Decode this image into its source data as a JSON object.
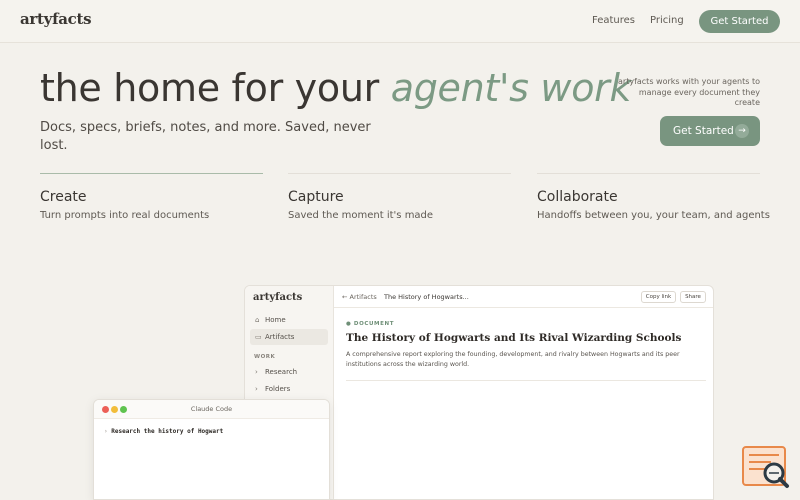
{
  "nav": {
    "logo": "artyfacts",
    "links": [
      "Features",
      "Pricing"
    ],
    "cta": "Get Started"
  },
  "hero": {
    "title_plain": "the home for your",
    "title_accent": "agent's work",
    "subtitle": "Docs, specs, briefs, notes, and more. Saved, never lost.",
    "side_note": "artyfacts works with your agents to manage every document they create",
    "cta": "Get Started",
    "cta_icon": "arrow-right-icon"
  },
  "features": [
    {
      "title": "Create",
      "desc": "Turn prompts into real documents"
    },
    {
      "title": "Capture",
      "desc": "Saved the moment it's made"
    },
    {
      "title": "Collaborate",
      "desc": "Handoffs between you, your team, and agents"
    }
  ],
  "app_preview": {
    "logo": "artyfacts",
    "sidebar": {
      "items": [
        {
          "label": "Home",
          "icon": "home-icon"
        },
        {
          "label": "Artifacts",
          "icon": "folder-icon"
        }
      ],
      "section": "WORK",
      "work_items": [
        {
          "label": "Research",
          "icon": "chevron-right-icon"
        },
        {
          "label": "Folders",
          "icon": "chevron-right-icon"
        }
      ]
    },
    "topbar": {
      "back": "← Artifacts",
      "current": "The History of Hogwarts...",
      "copy_link": "Copy link",
      "share": "Share"
    },
    "document": {
      "label": "● DOCUMENT",
      "title": "The History of Hogwarts and Its Rival Wizarding Schools",
      "description": "A comprehensive report exploring the founding, development, and rivalry between Hogwarts and its peer institutions across the wizarding world."
    }
  },
  "terminal": {
    "title": "Claude Code",
    "prompt": "›",
    "command": "Research the history of Hogwart"
  },
  "colors": {
    "background": "#f3f1ec",
    "accent": "#799580",
    "accent_text": "#7c9a84",
    "widget": "#e8894a"
  }
}
